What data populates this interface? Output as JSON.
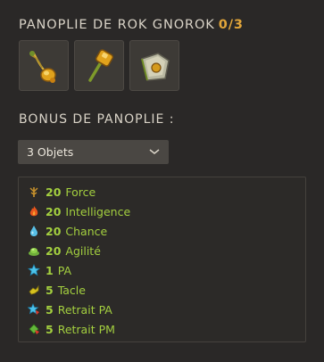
{
  "set": {
    "title": "PANOPLIE DE ROK GNOROK",
    "count": "0/3",
    "items": [
      {
        "icon": "amulet-icon"
      },
      {
        "icon": "hammer-icon"
      },
      {
        "icon": "shield-icon"
      }
    ]
  },
  "bonus": {
    "title": "BONUS DE PANOPLIE :",
    "selected": "3 Objets",
    "lines": [
      {
        "value": "20",
        "label": "Force",
        "icon": "force-icon"
      },
      {
        "value": "20",
        "label": "Intelligence",
        "icon": "intelligence-icon"
      },
      {
        "value": "20",
        "label": "Chance",
        "icon": "chance-icon"
      },
      {
        "value": "20",
        "label": "Agilité",
        "icon": "agility-icon"
      },
      {
        "value": "1",
        "label": "PA",
        "icon": "pa-icon"
      },
      {
        "value": "5",
        "label": "Tacle",
        "icon": "tackle-icon"
      },
      {
        "value": "5",
        "label": "Retrait PA",
        "icon": "ap-reduction-icon"
      },
      {
        "value": "5",
        "label": "Retrait PM",
        "icon": "mp-reduction-icon"
      }
    ]
  },
  "colors": {
    "accent": "#e2a63a",
    "bonus_green": "#a3cf3f",
    "background": "#2a2827"
  }
}
